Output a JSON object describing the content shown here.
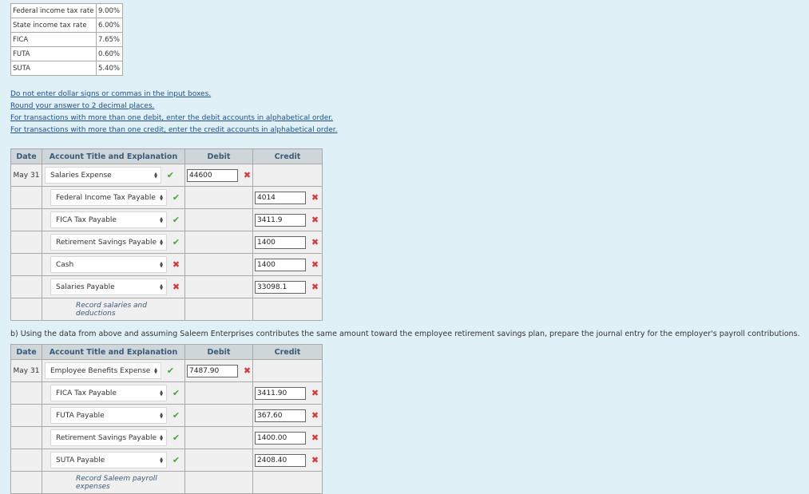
{
  "rates": [
    {
      "label": "Federal income tax rate",
      "value": "9.00%"
    },
    {
      "label": "State income tax rate",
      "value": "6.00%"
    },
    {
      "label": "FICA",
      "value": "7.65%"
    },
    {
      "label": "FUTA",
      "value": "0.60%"
    },
    {
      "label": "SUTA",
      "value": "5.40%"
    }
  ],
  "instructions": [
    "Do not enter dollar signs or commas in the input boxes.",
    "Round your answer to 2 decimal places.",
    "For transactions with more than one debit, enter the debit accounts in alphabetical order.",
    "For transactions with more than one credit, enter the credit accounts in alphabetical order."
  ],
  "headers": {
    "date": "Date",
    "account": "Account Title and Explanation",
    "debit": "Debit",
    "credit": "Credit"
  },
  "entry1": {
    "date": "May 31",
    "debit_account": "Salaries Expense",
    "debit_value": "44600",
    "credits": [
      {
        "account": "Federal Income Tax Payable",
        "value": "4014",
        "account_status": "correct"
      },
      {
        "account": "FICA Tax Payable",
        "value": "3411.9",
        "account_status": "correct"
      },
      {
        "account": "Retirement Savings Payable",
        "value": "1400",
        "account_status": "correct"
      },
      {
        "account": "Cash",
        "value": "1400",
        "account_status": "incorrect"
      },
      {
        "account": "Salaries Payable",
        "value": "33098.1",
        "account_status": "incorrect"
      }
    ],
    "explanation": "Record salaries and deductions"
  },
  "question_b": "b) Using the data from above and assuming Saleem Enterprises contributes the same amount toward the employee retirement savings plan, prepare the journal entry for the employer's payroll contributions.",
  "entry2": {
    "date": "May 31",
    "debit_account": "Employee Benefits Expense",
    "debit_value": "7487.90",
    "credits": [
      {
        "account": "FICA Tax Payable",
        "value": "3411.90",
        "account_status": "correct"
      },
      {
        "account": "FUTA Payable",
        "value": "367.60",
        "account_status": "correct"
      },
      {
        "account": "Retirement Savings Payable",
        "value": "1400.00",
        "account_status": "correct"
      },
      {
        "account": "SUTA Payable",
        "value": "2408.40",
        "account_status": "correct"
      }
    ],
    "explanation": "Record Saleem payroll expenses"
  },
  "colors": {
    "background": "#dff0f6",
    "header": "#cfd6da",
    "check": "#3cab2e",
    "cross": "#d9383a",
    "link": "#1f4e8a"
  },
  "icons": {
    "correct": "check-icon",
    "incorrect": "cross-icon",
    "dropdown": "dropdown-arrows-icon"
  }
}
